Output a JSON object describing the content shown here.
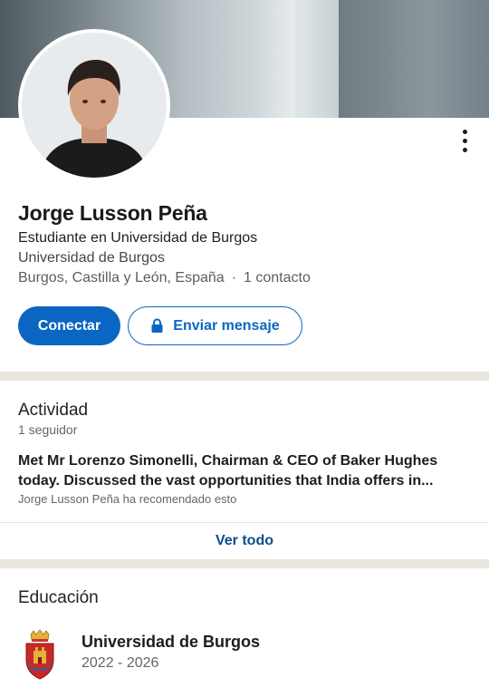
{
  "profile": {
    "name": "Jorge Lusson Peña",
    "headline": "Estudiante en Universidad de Burgos",
    "school": "Universidad de Burgos",
    "location": "Burgos, Castilla y León, España",
    "separator": "·",
    "contacts": "1 contacto"
  },
  "actions": {
    "connect_label": "Conectar",
    "message_label": "Enviar mensaje",
    "message_icon": "lock-icon",
    "more_icon": "more-vertical-icon"
  },
  "activity": {
    "title": "Actividad",
    "followers": "1 seguidor",
    "post_text": "Met Mr Lorenzo Simonelli, Chairman & CEO of Baker Hughes today. Discussed the vast opportunities that India offers in...",
    "post_meta": "Jorge Lusson Peña ha recomendado esto",
    "see_all": "Ver todo"
  },
  "education": {
    "title": "Educación",
    "items": [
      {
        "school": "Universidad de Burgos",
        "years": "2022 - 2026",
        "logo_icon": "university-crest-icon"
      }
    ]
  },
  "colors": {
    "accent": "#0a66c2",
    "link": "#0a4d8c",
    "divider": "#e9e5df"
  }
}
